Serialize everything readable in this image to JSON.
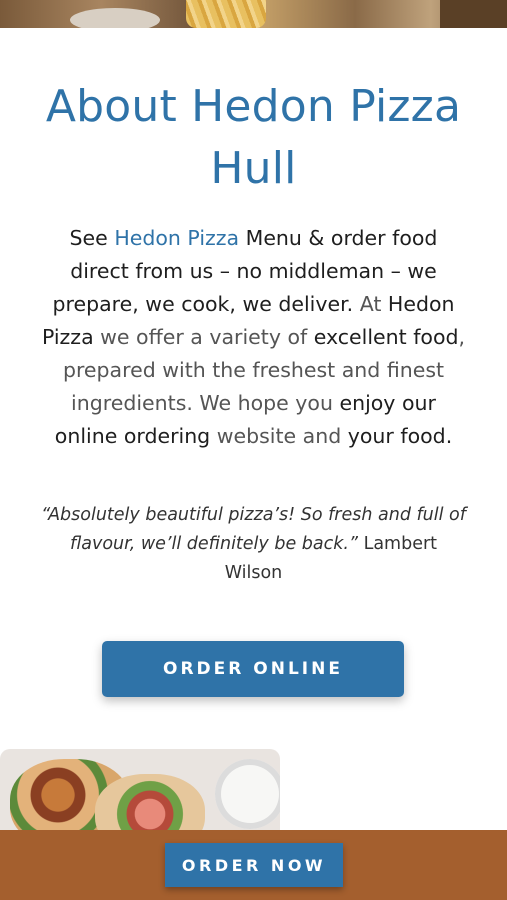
{
  "about": {
    "title": "About Hedon Pizza Hull",
    "intro": {
      "p1": "See ",
      "link": "Hedon Pizza",
      "p2": " Menu & order food direct from us – no middleman – we prepare, we cook, we deliver.",
      "p3": " At ",
      "p4": "Hedon Pizza",
      "p5": " we offer a variety of ",
      "p6": "excellent food",
      "p7": ", prepared with the freshest and finest ingredients. We hope you ",
      "p8": "enjoy our online ordering",
      "p9": " website and ",
      "p10": "your food",
      "p11": "."
    },
    "testimonial": {
      "quote": "“Absolutely beautiful pizza’s! So fresh and full of flavour, we’ll definitely be back.”",
      "author": " Lambert Wilson"
    }
  },
  "buttons": {
    "order_online": "ORDER ONLINE",
    "order_now": "ORDER NOW"
  },
  "colors": {
    "brand_blue": "#2f73a8",
    "bottom_bar": "#a45f2e"
  }
}
